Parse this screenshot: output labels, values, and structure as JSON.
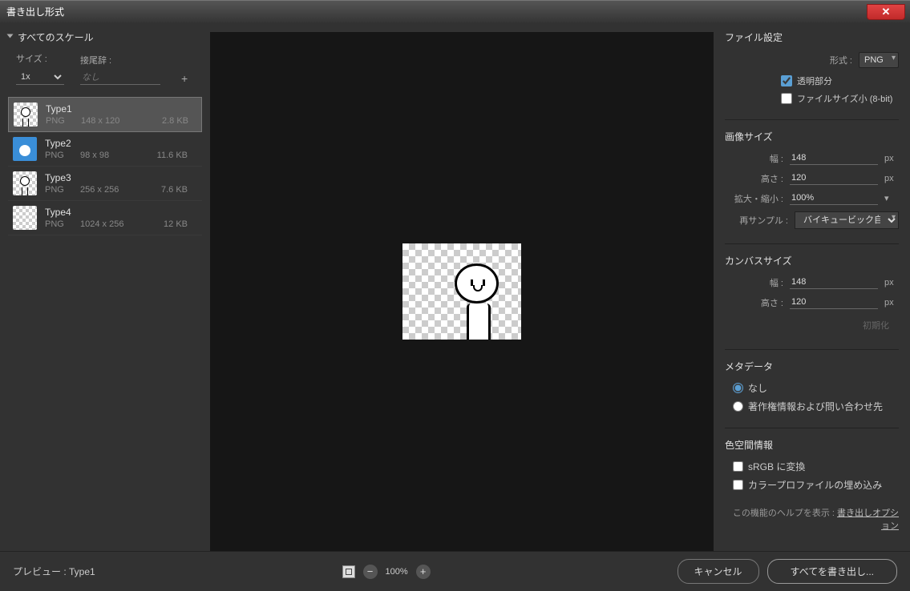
{
  "title": "書き出し形式",
  "left": {
    "section_title": "すべてのスケール",
    "size_label": "サイズ :",
    "suffix_label": "接尾辞 :",
    "size_value": "1x",
    "suffix_placeholder": "なし",
    "types": [
      {
        "name": "Type1",
        "format": "PNG",
        "dims": "148 x 120",
        "size": "2.8 KB",
        "selected": true,
        "thumb": "checker"
      },
      {
        "name": "Type2",
        "format": "PNG",
        "dims": "98 x 98",
        "size": "11.6 KB",
        "selected": false,
        "thumb": "blue"
      },
      {
        "name": "Type3",
        "format": "PNG",
        "dims": "256 x 256",
        "size": "7.6 KB",
        "selected": false,
        "thumb": "checker"
      },
      {
        "name": "Type4",
        "format": "PNG",
        "dims": "1024 x 256",
        "size": "12 KB",
        "selected": false,
        "thumb": "checker"
      }
    ]
  },
  "right": {
    "file_settings": {
      "title": "ファイル設定",
      "format_label": "形式 :",
      "format_value": "PNG",
      "transparent_label": "透明部分",
      "small_file_label": "ファイルサイズ小 (8-bit)"
    },
    "image_size": {
      "title": "画像サイズ",
      "width_label": "幅 :",
      "width_value": "148",
      "height_label": "高さ :",
      "height_value": "120",
      "scale_label": "拡大・縮小 :",
      "scale_value": "100%",
      "resample_label": "再サンプル :",
      "resample_value": "バイキュービック自動",
      "px": "px"
    },
    "canvas_size": {
      "title": "カンバスサイズ",
      "width_label": "幅 :",
      "width_value": "148",
      "height_label": "高さ :",
      "height_value": "120",
      "reset_label": "初期化",
      "px": "px"
    },
    "metadata": {
      "title": "メタデータ",
      "none_label": "なし",
      "copyright_label": "著作権情報および問い合わせ先"
    },
    "colorspace": {
      "title": "色空間情報",
      "srgb_label": "sRGB に変換",
      "embed_label": "カラープロファイルの埋め込み"
    },
    "help_prefix": "この機能のヘルプを表示 : ",
    "help_link": "書き出しオプション"
  },
  "footer": {
    "preview_label": "プレビュー : Type1",
    "zoom_value": "100%",
    "cancel_label": "キャンセル",
    "export_label": "すべてを書き出し..."
  }
}
